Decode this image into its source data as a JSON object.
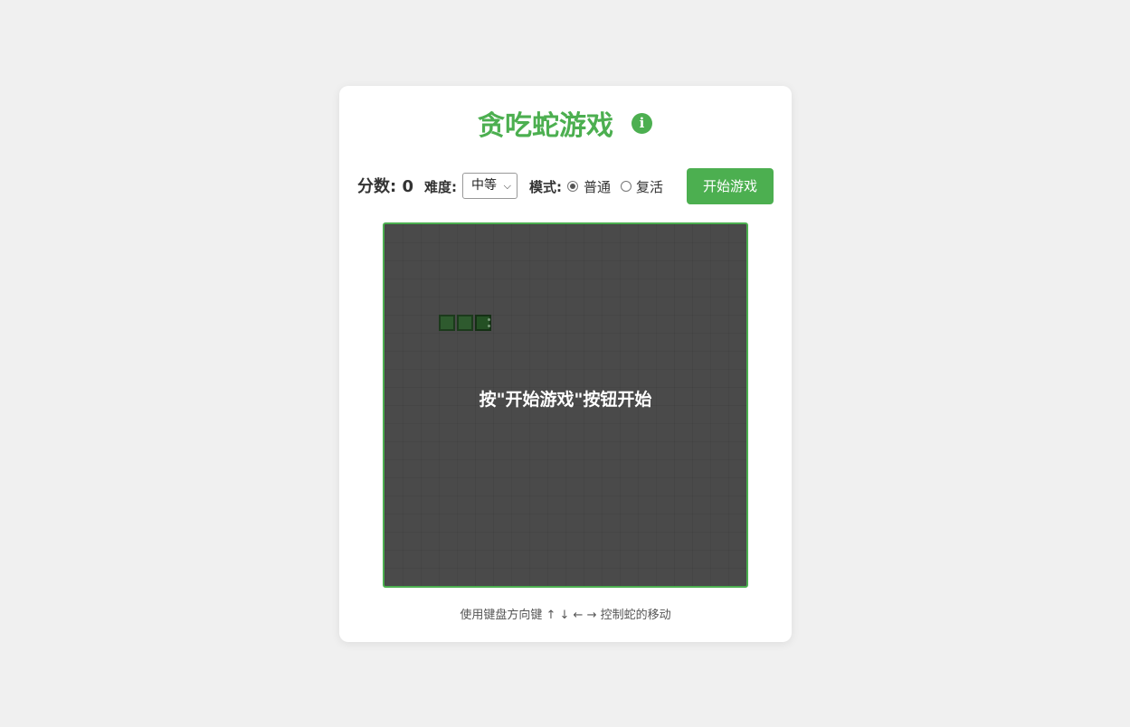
{
  "header": {
    "title": "贪吃蛇游戏",
    "info_icon": "info-icon",
    "info_icon_glyph": "i"
  },
  "controls": {
    "score_label": "分数:",
    "score_value": "0",
    "difficulty_label": "难度:",
    "difficulty_selected": "中等",
    "difficulty_chevron_icon": "chevron-down-icon",
    "mode_label": "模式:",
    "mode_options": [
      {
        "label": "普通",
        "checked": true
      },
      {
        "label": "复活",
        "checked": false
      }
    ],
    "start_button_label": "开始游戏"
  },
  "board": {
    "overlay_text": "按\"开始游戏\"按钮开始",
    "grid_columns": 20,
    "grid_rows": 20,
    "snake": [
      {
        "col": 3,
        "row": 5
      },
      {
        "col": 4,
        "row": 5
      },
      {
        "col": 5,
        "row": 5
      }
    ],
    "snake_direction": "right",
    "colors": {
      "background": "#4a4a4a",
      "border": "#4caf50",
      "snake_body": "#2e5a2e"
    }
  },
  "footer": {
    "instructions": "使用键盘方向键 ↑ ↓ ← → 控制蛇的移动"
  },
  "theme": {
    "accent": "#4caf50",
    "page_background": "#f0f0f0"
  }
}
